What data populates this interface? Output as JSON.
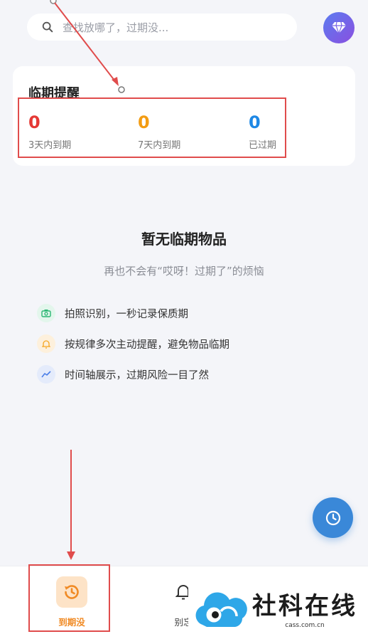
{
  "search": {
    "placeholder": "查找放哪了，过期没..."
  },
  "premium": {
    "icon": "diamond-icon"
  },
  "reminder": {
    "title": "临期提醒",
    "stats": [
      {
        "value": "0",
        "label": "3天内到期",
        "color": "#e53935"
      },
      {
        "value": "0",
        "label": "7天内到期",
        "color": "#f39c12"
      },
      {
        "value": "0",
        "label": "已过期",
        "color": "#1e88e5"
      }
    ]
  },
  "empty": {
    "title": "暂无临期物品",
    "subtitle": "再也不会有“哎呀！过期了”的烦恼",
    "features": [
      {
        "icon": "camera-icon",
        "text": "拍照识别，一秒记录保质期",
        "color": "#2bb673",
        "bg": "#e3f6ec"
      },
      {
        "icon": "bell-icon",
        "text": "按规律多次主动提醒，避免物品临期",
        "color": "#f5a623",
        "bg": "#fdf0dc"
      },
      {
        "icon": "trend-icon",
        "text": "时间轴展示，过期风险一目了然",
        "color": "#4a7ee8",
        "bg": "#e4ebfb"
      }
    ]
  },
  "fab": {
    "icon": "clock-icon"
  },
  "tabbar": {
    "tabs": [
      {
        "label": "到期没",
        "icon": "history-icon",
        "active": true
      },
      {
        "label": "别忘",
        "icon": "bell-icon",
        "active": false
      }
    ]
  },
  "watermark": {
    "text": "社科在线",
    "sub": "cass.com.cn"
  },
  "colors": {
    "accent": "#f08a24",
    "annotation": "#e04c4c",
    "fab": "#3a88d8"
  }
}
